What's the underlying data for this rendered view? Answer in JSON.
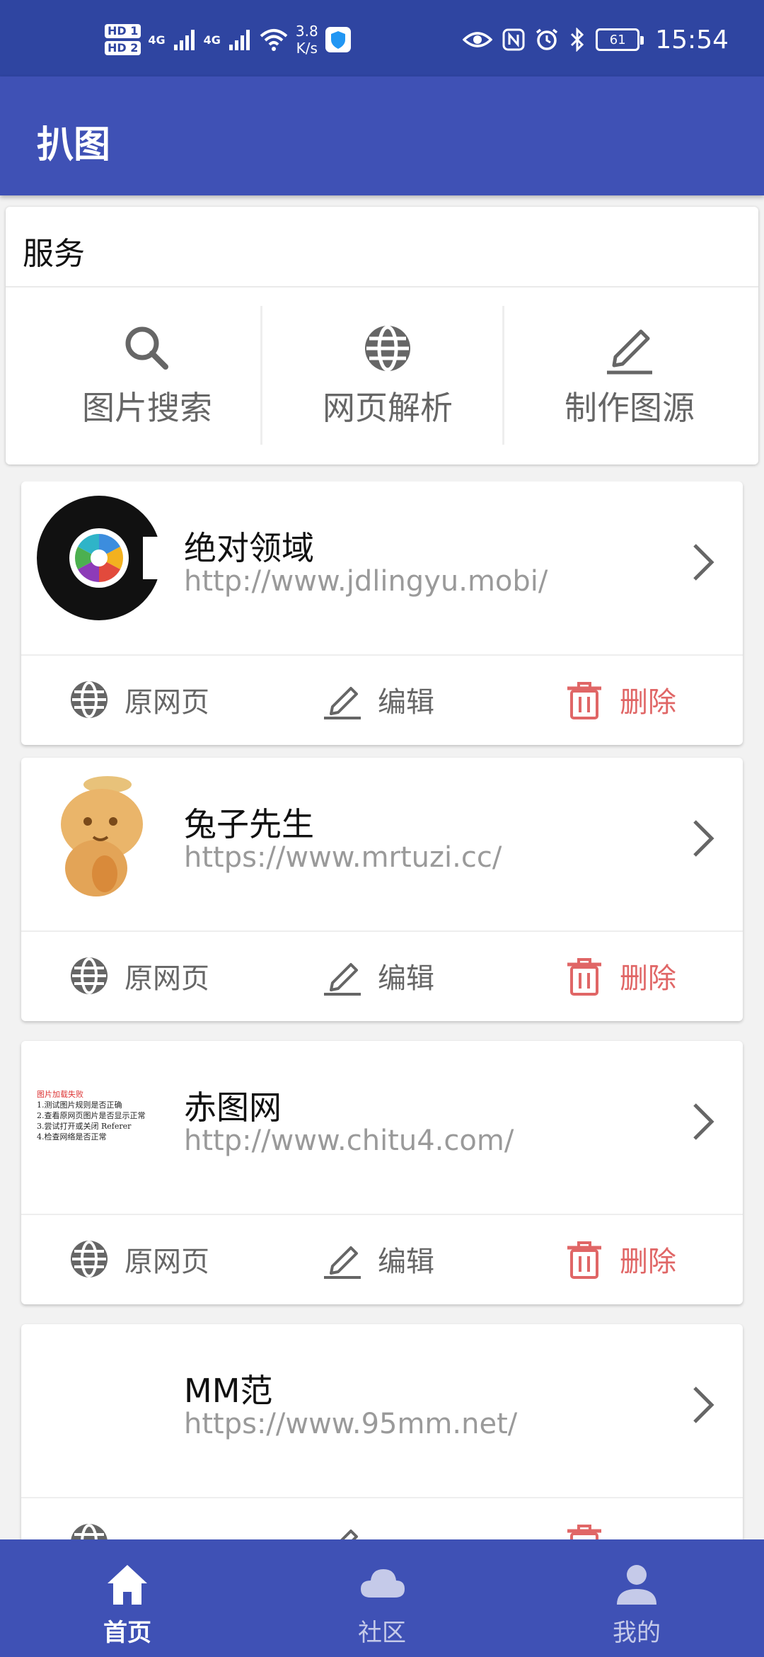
{
  "status_bar": {
    "hd1": "HD 1",
    "hd2": "HD 2",
    "sig1": "4G",
    "sig2": "4G",
    "speed_value": "3.8",
    "speed_unit": "K/s",
    "battery": "61",
    "time": "15:54"
  },
  "app_bar": {
    "title": "扒图"
  },
  "services": {
    "title": "服务",
    "items": [
      {
        "label": "图片搜索",
        "icon": "search-icon"
      },
      {
        "label": "网页解析",
        "icon": "globe-icon"
      },
      {
        "label": "制作图源",
        "icon": "pencil-icon"
      }
    ]
  },
  "actions": {
    "open": "原网页",
    "edit": "编辑",
    "delete": "删除"
  },
  "sites": [
    {
      "name": "绝对领域",
      "url": "http://www.jdlingyu.mobi/"
    },
    {
      "name": "兔子先生",
      "url": "https://www.mrtuzi.cc/"
    },
    {
      "name": "赤图网",
      "url": "http://www.chitu4.com/",
      "thumb_error": {
        "title": "图片加载失败",
        "lines": [
          "1.测试图片规则是否正确",
          "2.查看原网页图片是否显示正常",
          "3.尝试打开或关闭 Referer",
          "4.检查网络是否正常"
        ]
      }
    },
    {
      "name": "MM范",
      "url": "https://www.95mm.net/"
    }
  ],
  "bottom_nav": [
    {
      "label": "首页",
      "icon": "home-icon",
      "active": true
    },
    {
      "label": "社区",
      "icon": "cloud-icon",
      "active": false
    },
    {
      "label": "我的",
      "icon": "person-icon",
      "active": false
    }
  ],
  "colors": {
    "primary": "#3f51b5",
    "status": "#2f45a1",
    "danger": "#e06666"
  }
}
